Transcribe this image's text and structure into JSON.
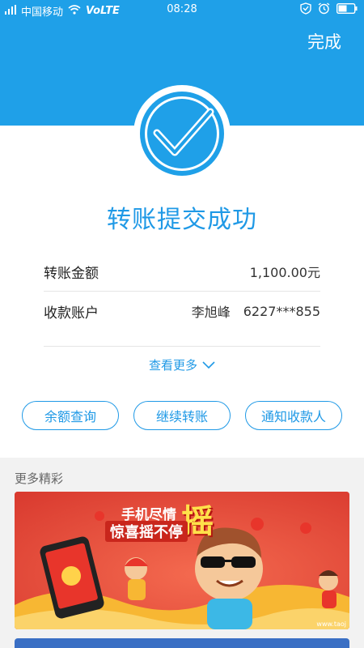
{
  "status_bar": {
    "carrier": "中国移动",
    "network": "VoLTE",
    "time": "08:28"
  },
  "header": {
    "done_label": "完成"
  },
  "result": {
    "title": "转账提交成功"
  },
  "details": {
    "amount_label": "转账金额",
    "amount_value": "1,100.00元",
    "account_label": "收款账户",
    "payee_name": "李旭峰",
    "account_number": "6227***855",
    "view_more_label": "查看更多"
  },
  "actions": {
    "balance_query": "余额查询",
    "continue_transfer": "继续转账",
    "notify_payee": "通知收款人"
  },
  "promo": {
    "section_label": "更多精彩",
    "banner_line1": "手机尽情",
    "banner_line2": "惊喜摇不停",
    "banner_big": "摇",
    "banner_footer": "www.taoj"
  },
  "colors": {
    "accent": "#1fa0e8",
    "banner": "#e84a3d"
  }
}
